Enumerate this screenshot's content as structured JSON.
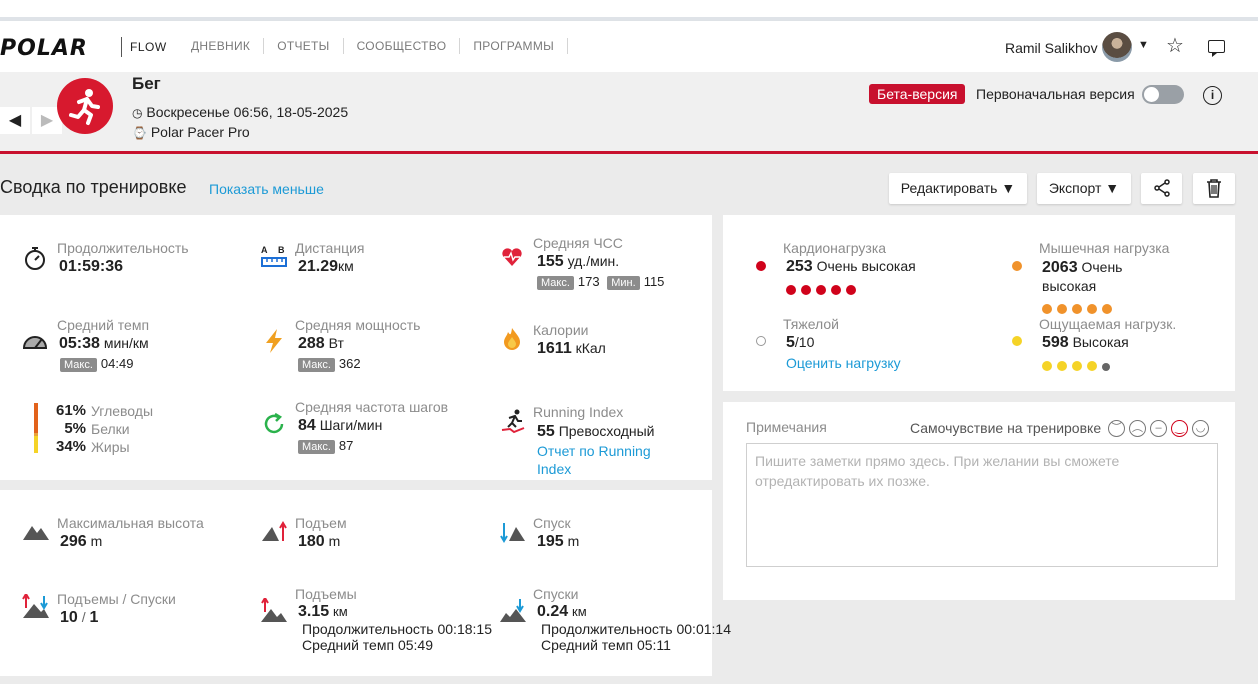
{
  "nav": {
    "logo": "POLAR",
    "product": "FLOW",
    "links": [
      "ДНЕВНИК",
      "ОТЧЕТЫ",
      "СООБЩЕСТВО",
      "ПРОГРАММЫ"
    ],
    "user": "Ramil Salikhov"
  },
  "header": {
    "sport": "Бег",
    "datetime": "Воскресенье 06:56, 18-05-2025",
    "device": "Polar Pacer Pro",
    "beta_label": "Бета-версия",
    "original_label": "Первоначальная версия"
  },
  "summary": {
    "title": "Сводка по тренировке",
    "show_less": "Показать меньше",
    "edit": "Редактировать ▼",
    "export": "Экспорт ▼"
  },
  "stats": {
    "duration": {
      "label": "Продолжительность",
      "value": "01:59:36"
    },
    "distance": {
      "label": "Дистанция",
      "value": "21.29",
      "unit": "км"
    },
    "hr": {
      "label": "Средняя ЧСС",
      "value": "155",
      "unit": "уд./мин.",
      "max_label": "Макс.",
      "max": "173",
      "min_label": "Мин.",
      "min": "115"
    },
    "pace": {
      "label": "Средний темп",
      "value": "05:38",
      "unit": "мин/км",
      "max_label": "Макс.",
      "max": "04:49"
    },
    "power": {
      "label": "Средняя мощность",
      "value": "288",
      "unit": "Вт",
      "max_label": "Макс.",
      "max": "362"
    },
    "calories": {
      "label": "Калории",
      "value": "1611",
      "unit": "кКал"
    },
    "fuel": [
      {
        "pct": "61%",
        "name": "Углеводы"
      },
      {
        "pct": "5%",
        "name": "Белки"
      },
      {
        "pct": "34%",
        "name": "Жиры"
      }
    ],
    "cadence": {
      "label": "Средняя частота шагов",
      "value": "84",
      "unit": "Шаги/мин",
      "max_label": "Макс.",
      "max": "87"
    },
    "running_index": {
      "label": "Running Index",
      "value": "55",
      "desc": "Превосходный",
      "link": "Отчет по Running Index"
    }
  },
  "elevation": {
    "max_alt": {
      "label": "Максимальная высота",
      "value": "296",
      "unit": "m"
    },
    "ascent": {
      "label": "Подъем",
      "value": "180",
      "unit": "m"
    },
    "descent": {
      "label": "Спуск",
      "value": "195",
      "unit": "m"
    },
    "counts": {
      "label": "Подъемы / Спуски",
      "up": "10",
      "sep": "/",
      "down": "1"
    },
    "uphills": {
      "label": "Подъемы",
      "value": "3.15",
      "unit": "км",
      "dur": "Продолжительность 00:18:15",
      "pace": "Средний темп 05:49"
    },
    "downhills": {
      "label": "Спуски",
      "value": "0.24",
      "unit": "км",
      "dur": "Продолжительность 00:01:14",
      "pace": "Средний темп 05:11"
    }
  },
  "load": {
    "cardio": {
      "label": "Кардионагрузка",
      "value": "253",
      "desc": "Очень высокая",
      "dots": 5,
      "color": "#d0021b"
    },
    "muscle": {
      "label": "Мышечная нагрузка",
      "value": "2063",
      "desc": "Очень высокая",
      "dots": 5,
      "color": "#f0922b"
    },
    "rpe": {
      "label": "Тяжелой",
      "value": "5",
      "max": "/10",
      "link": "Оценить нагрузку"
    },
    "perceived": {
      "label": "Ощущаемая нагрузк.",
      "value": "598",
      "desc": "Высокая",
      "dots_on": 4,
      "color": "#f5d327"
    }
  },
  "notes": {
    "label": "Примечания",
    "feeling_label": "Самочувствие на тренировке",
    "placeholder": "Пишите заметки прямо здесь. При желании вы сможете отредактировать их позже."
  }
}
